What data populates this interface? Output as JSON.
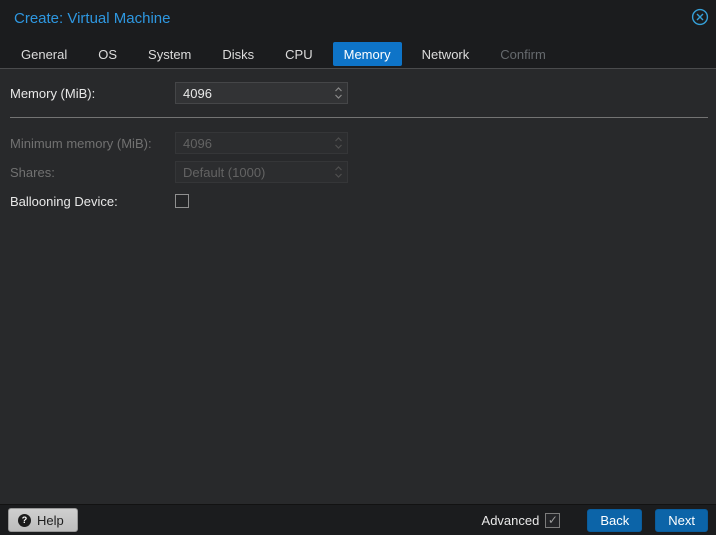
{
  "window": {
    "title": "Create: Virtual Machine"
  },
  "tabs": [
    {
      "label": "General",
      "state": "normal"
    },
    {
      "label": "OS",
      "state": "normal"
    },
    {
      "label": "System",
      "state": "normal"
    },
    {
      "label": "Disks",
      "state": "normal"
    },
    {
      "label": "CPU",
      "state": "normal"
    },
    {
      "label": "Memory",
      "state": "selected"
    },
    {
      "label": "Network",
      "state": "normal"
    },
    {
      "label": "Confirm",
      "state": "disabled"
    }
  ],
  "form": {
    "memory": {
      "label": "Memory (MiB):",
      "value": "4096",
      "control": "number-spinner",
      "disabled": false
    },
    "min_memory": {
      "label": "Minimum memory (MiB):",
      "value": "4096",
      "control": "number-spinner",
      "disabled": true
    },
    "shares": {
      "label": "Shares:",
      "value": "Default (1000)",
      "control": "number-spinner",
      "disabled": true
    },
    "ballooning": {
      "label": "Ballooning Device:",
      "control": "checkbox",
      "checked": false
    }
  },
  "footer": {
    "help": "Help",
    "advanced_label": "Advanced",
    "advanced_checked": true,
    "back": "Back",
    "next": "Next"
  },
  "colors": {
    "title_blue": "#2e97e0",
    "tab_selected_blue": "#0e74c8",
    "button_blue": "#0c64a8",
    "panel_bg": "#28292b",
    "outer_bg": "#1b1c1e"
  }
}
